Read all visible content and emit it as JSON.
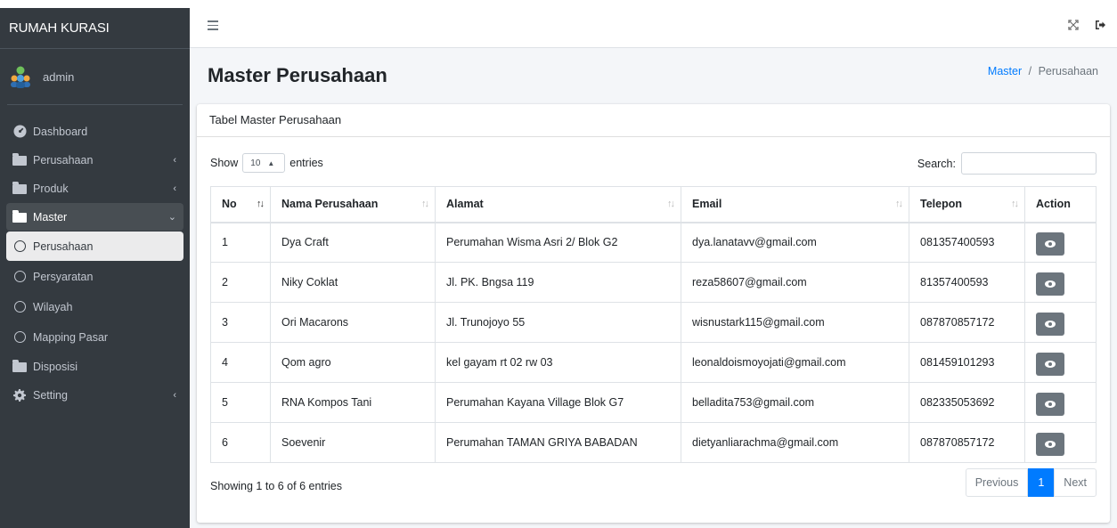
{
  "app": {
    "brand": "RUMAH KURASI"
  },
  "user": {
    "name": "admin"
  },
  "sidebar": {
    "items": [
      {
        "label": "Dashboard",
        "icon": "tachometer-icon"
      },
      {
        "label": "Perusahaan",
        "icon": "folder-icon",
        "caret": "‹"
      },
      {
        "label": "Produk",
        "icon": "folder-icon",
        "caret": "‹"
      },
      {
        "label": "Master",
        "icon": "folder-icon",
        "caret": "⌄"
      },
      {
        "label": "Perusahaan",
        "icon": "circle-icon"
      },
      {
        "label": "Persyaratan",
        "icon": "circle-icon"
      },
      {
        "label": "Wilayah",
        "icon": "circle-icon"
      },
      {
        "label": "Mapping Pasar",
        "icon": "circle-icon"
      },
      {
        "label": "Disposisi",
        "icon": "folder-icon"
      },
      {
        "label": "Setting",
        "icon": "gear-icon",
        "caret": "‹"
      }
    ]
  },
  "page": {
    "title": "Master Perusahaan",
    "breadcrumb": {
      "link": "Master",
      "separator": "/",
      "current": "Perusahaan"
    }
  },
  "card": {
    "title": "Tabel Master Perusahaan",
    "show_label": "Show",
    "entries_value": "10",
    "entries_label": "entries",
    "search_label": "Search:",
    "search_value": ""
  },
  "table": {
    "headers": [
      "No",
      "Nama Perusahaan",
      "Alamat",
      "Email",
      "Telepon",
      "Action"
    ],
    "rows": [
      [
        "1",
        "Dya Craft",
        "Perumahan Wisma Asri 2/ Blok G2",
        "dya.lanatavv@gmail.com",
        "081357400593"
      ],
      [
        "2",
        "Niky Coklat",
        "Jl. PK. Bngsa 119",
        "reza58607@gmail.com",
        "81357400593"
      ],
      [
        "3",
        "Ori Macarons",
        "Jl. Trunojoyo 55",
        "wisnustark115@gmail.com",
        "087870857172"
      ],
      [
        "4",
        "Qom agro",
        "kel gayam rt 02 rw 03",
        "leonaldoismoyojati@gmail.com",
        "081459101293"
      ],
      [
        "5",
        "RNA Kompos Tani",
        "Perumahan Kayana Village Blok G7",
        "belladita753@gmail.com",
        "082335053692"
      ],
      [
        "6",
        "Soevenir",
        "Perumahan TAMAN GRIYA BABADAN",
        "dietyanliarachma@gmail.com",
        "087870857172"
      ]
    ]
  },
  "footer": {
    "info": "Showing 1 to 6 of 6 entries"
  },
  "pagination": {
    "previous": "Previous",
    "current": "1",
    "next": "Next"
  },
  "colors": {
    "sidebar": "#343a40",
    "primary": "#007bff",
    "action_button": "#6c757d"
  }
}
